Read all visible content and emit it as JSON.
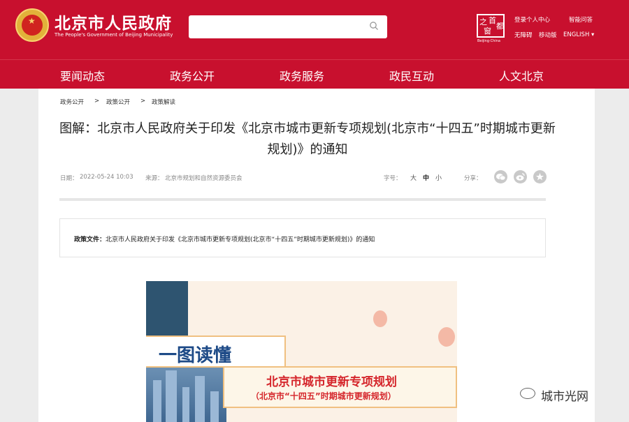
{
  "header": {
    "site_title": "北京市人民政府",
    "site_subtitle": "The People's Government of Beijing Municipality",
    "capital_logo_chars": [
      "之",
      "首",
      "都",
      "窗"
    ],
    "capital_logo_sub": "Beijing·China",
    "links": {
      "login": "登录个人中心",
      "smart_qa": "智能问答",
      "accessibility": "无障碍",
      "mobile": "移动版",
      "english": "ENGLISH ▾"
    },
    "search": {
      "placeholder": ""
    }
  },
  "nav": [
    "要闻动态",
    "政务公开",
    "政务服务",
    "政民互动",
    "人文北京"
  ],
  "breadcrumb": [
    "政务公开",
    "政策公开",
    "政策解读"
  ],
  "breadcrumb_sep": ">",
  "article": {
    "title": "图解：北京市人民政府关于印发《北京市城市更新专项规划(北京市“十四五”时期城市更新规划)》的通知",
    "date_label": "日期：",
    "date": "2022-05-24 10:03",
    "source_label": "来源：",
    "source": "北京市规划和自然资源委员会",
    "font_size_label": "字号：",
    "font_sizes": [
      "大",
      "中",
      "小"
    ],
    "share_label": "分享："
  },
  "policy": {
    "label": "政策文件：",
    "text": "北京市人民政府关于印发《北京市城市更新专项规划(北京市“十四五”时期城市更新规划)》的通知"
  },
  "infographic": {
    "title": "一图读懂",
    "main": "北京市城市更新专项规划",
    "sub": "（北京市“十四五”时期城市更新规划）"
  },
  "watermark": "城市光网",
  "colors": {
    "brand_red": "#c8102e"
  }
}
